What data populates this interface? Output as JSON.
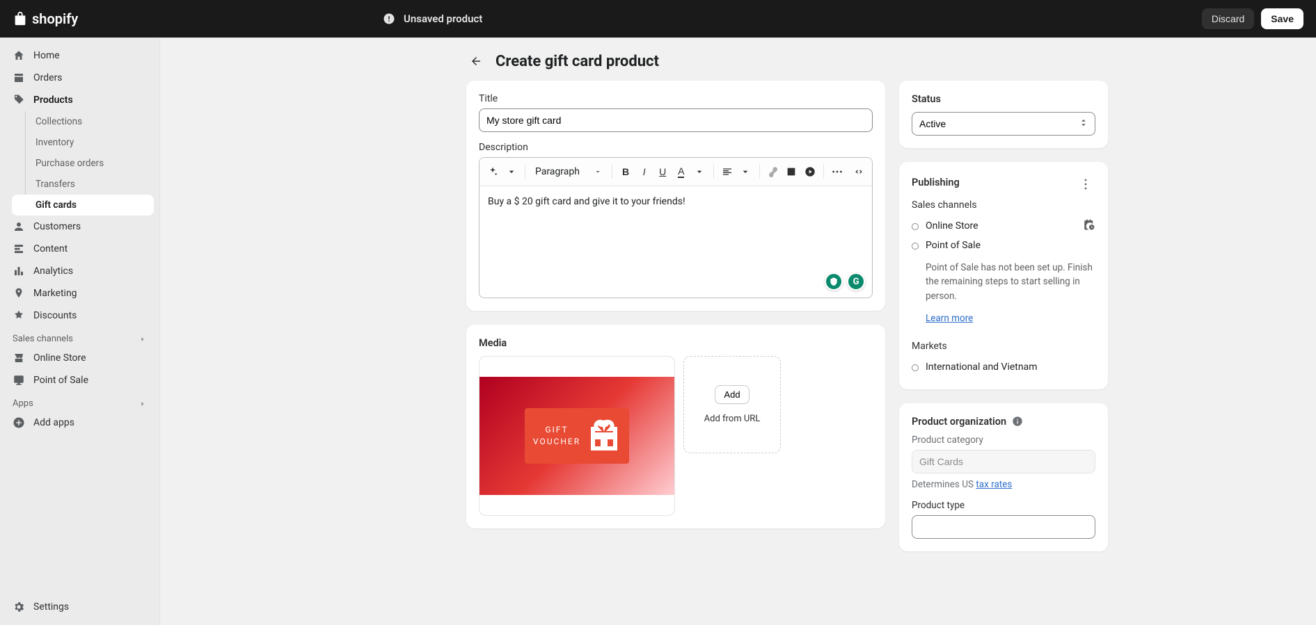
{
  "brand": "shopify",
  "topbar": {
    "status": "Unsaved product",
    "discard": "Discard",
    "save": "Save"
  },
  "sidebar": {
    "home": "Home",
    "orders": "Orders",
    "products": "Products",
    "collections": "Collections",
    "inventory": "Inventory",
    "purchase_orders": "Purchase orders",
    "transfers": "Transfers",
    "gift_cards": "Gift cards",
    "customers": "Customers",
    "content": "Content",
    "analytics": "Analytics",
    "marketing": "Marketing",
    "discounts": "Discounts",
    "sales_channels_header": "Sales channels",
    "online_store": "Online Store",
    "point_of_sale": "Point of Sale",
    "apps_header": "Apps",
    "add_apps": "Add apps",
    "settings": "Settings"
  },
  "page": {
    "title": "Create gift card product"
  },
  "form": {
    "title_label": "Title",
    "title_value": "My store gift card",
    "description_label": "Description",
    "paragraph_label": "Paragraph",
    "description_value": "Buy a $ 20 gift card and give it to your friends!"
  },
  "media": {
    "heading": "Media",
    "voucher_line1": "GIFT",
    "voucher_line2": "VOUCHER",
    "add": "Add",
    "add_from_url": "Add from URL"
  },
  "status_card": {
    "heading": "Status",
    "value": "Active"
  },
  "publishing": {
    "heading": "Publishing",
    "sales_channels": "Sales channels",
    "online_store": "Online Store",
    "pos": "Point of Sale",
    "pos_hint": "Point of Sale has not been set up. Finish the remaining steps to start selling in person.",
    "learn_more": "Learn more",
    "markets": "Markets",
    "market_value": "International and Vietnam"
  },
  "organization": {
    "heading": "Product organization",
    "category_label": "Product category",
    "category_value": "Gift Cards",
    "tax_prefix": "Determines US ",
    "tax_link": "tax rates",
    "type_label": "Product type",
    "type_value": ""
  }
}
